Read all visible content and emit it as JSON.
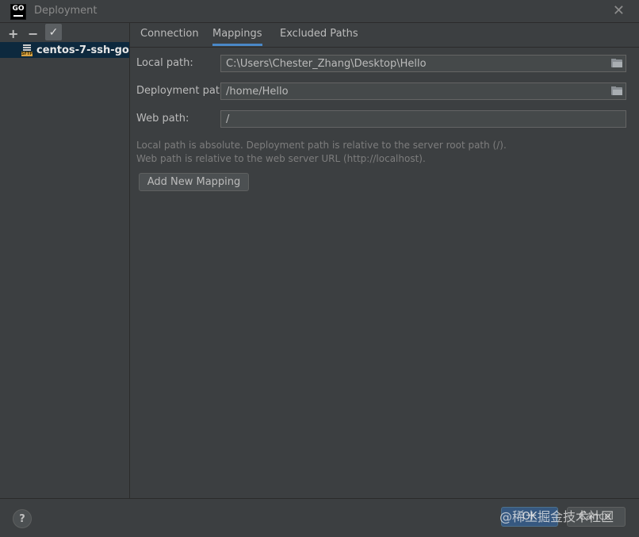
{
  "window": {
    "title": "Deployment",
    "app_icon_text": "GO"
  },
  "left_toolbar": {
    "add": "+",
    "remove": "−",
    "check": "✓"
  },
  "servers": [
    {
      "name": "centos-7-ssh-go",
      "icon_badge": "SFTP"
    }
  ],
  "tabs": [
    {
      "label": "Connection"
    },
    {
      "label": "Mappings"
    },
    {
      "label": "Excluded Paths"
    }
  ],
  "mappings": {
    "local_path": {
      "label": "Local path:",
      "value": "C:\\Users\\Chester_Zhang\\Desktop\\Hello"
    },
    "deployment_path": {
      "label": "Deployment path:",
      "value": "/home/Hello"
    },
    "web_path": {
      "label": "Web path:",
      "value": "/"
    },
    "hint_line1": "Local path is absolute. Deployment path is relative to the server root path (/).",
    "hint_line2": "Web path is relative to the web server URL (http://localhost).",
    "add_button": "Add New Mapping"
  },
  "footer": {
    "help": "?",
    "ok": "OK",
    "cancel": "Cancel",
    "watermark": "@稀土掘金技术社区"
  },
  "colors": {
    "background": "#3c3f41",
    "selection": "#0d293e",
    "accent_tab": "#4a88c7",
    "ok_button": "#365880"
  }
}
